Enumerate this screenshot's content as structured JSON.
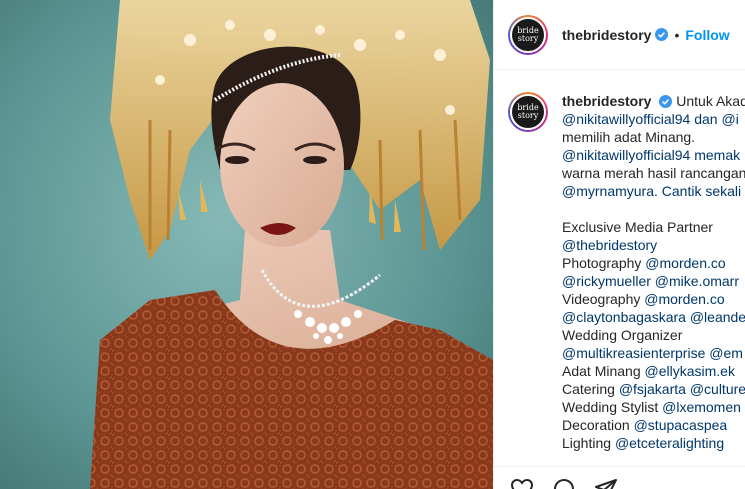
{
  "post": {
    "author": "thebridestory",
    "follow_label": "Follow",
    "dot": "•",
    "avatar_text": "bride story"
  },
  "caption": {
    "author": "thebridestory",
    "lines": [
      "Untuk Akad",
      "@nikitawillyofficial94 dan @i",
      "memilih adat Minang.",
      "@nikitawillyofficial94 memak",
      "warna merah hasil rancangan",
      "@myrnamyura. Cantik sekali"
    ],
    "credits": [
      {
        "label": "Exclusive Media Partner",
        "handle": ""
      },
      {
        "label": "",
        "handle": "@thebridestory"
      },
      {
        "label": "Photography ",
        "handle": "@morden.co"
      },
      {
        "label": "",
        "handle": "@rickymueller @mike.omarr"
      },
      {
        "label": "Videography ",
        "handle": "@morden.co"
      },
      {
        "label": "",
        "handle": "@claytonbagaskara @leande"
      },
      {
        "label": "Wedding Organizer",
        "handle": ""
      },
      {
        "label": "",
        "handle": "@multikreasienterprise @em"
      },
      {
        "label": "Adat Minang ",
        "handle": "@ellykasim.ek"
      },
      {
        "label": "Catering ",
        "handle": "@fsjakarta @culture"
      },
      {
        "label": "Wedding Stylist ",
        "handle": "@lxemomen"
      },
      {
        "label": "Decoration ",
        "handle": "@stupacaspea"
      },
      {
        "label": "Lighting ",
        "handle": "@etceteralighting"
      }
    ]
  },
  "colors": {
    "link": "#00376b",
    "follow": "#0095f6",
    "verified": "#3897f0",
    "background_photo": "#5e9a97",
    "dress": "#8a3a1c"
  },
  "icons": [
    "heart-icon",
    "comment-icon",
    "share-icon",
    "verified-badge-icon"
  ]
}
